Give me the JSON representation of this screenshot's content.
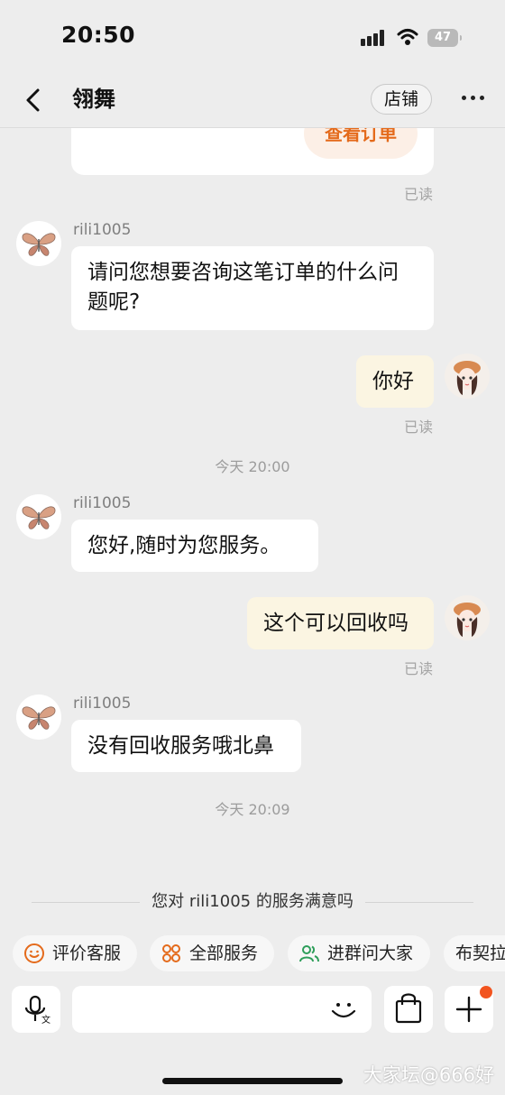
{
  "status_bar": {
    "time": "20:50",
    "battery": "47"
  },
  "header": {
    "title": "翎舞",
    "store_label": "店铺"
  },
  "chat": {
    "order_button": "查看订单",
    "messages": [
      {
        "sender": "rili1005",
        "text": "请问您想要咨询这笔订单的什么问题呢?"
      },
      {
        "text": "你好",
        "status": "已读"
      },
      {
        "sender": "rili1005",
        "text": "您好,随时为您服务。"
      },
      {
        "text": "这个可以回收吗",
        "status": "已读"
      },
      {
        "sender": "rili1005",
        "text": "没有回收服务哦北鼻"
      }
    ],
    "read_status": "已读",
    "timestamps": [
      "今天 20:00",
      "今天 20:09"
    ]
  },
  "survey": {
    "text": "您对 rili1005 的服务满意吗"
  },
  "quick_actions": [
    {
      "label": "评价客服",
      "icon": "smile-icon"
    },
    {
      "label": "全部服务",
      "icon": "grid-icon"
    },
    {
      "label": "进群问大家",
      "icon": "group-icon"
    },
    {
      "label": "布契拉",
      "icon": "none"
    }
  ],
  "input_bar": {
    "placeholder": ""
  },
  "watermark": "大家坛@666好",
  "colors": {
    "accent": "#e46a1b",
    "outgoing_bubble": "#fbf5e2",
    "badge": "#f2541f"
  }
}
